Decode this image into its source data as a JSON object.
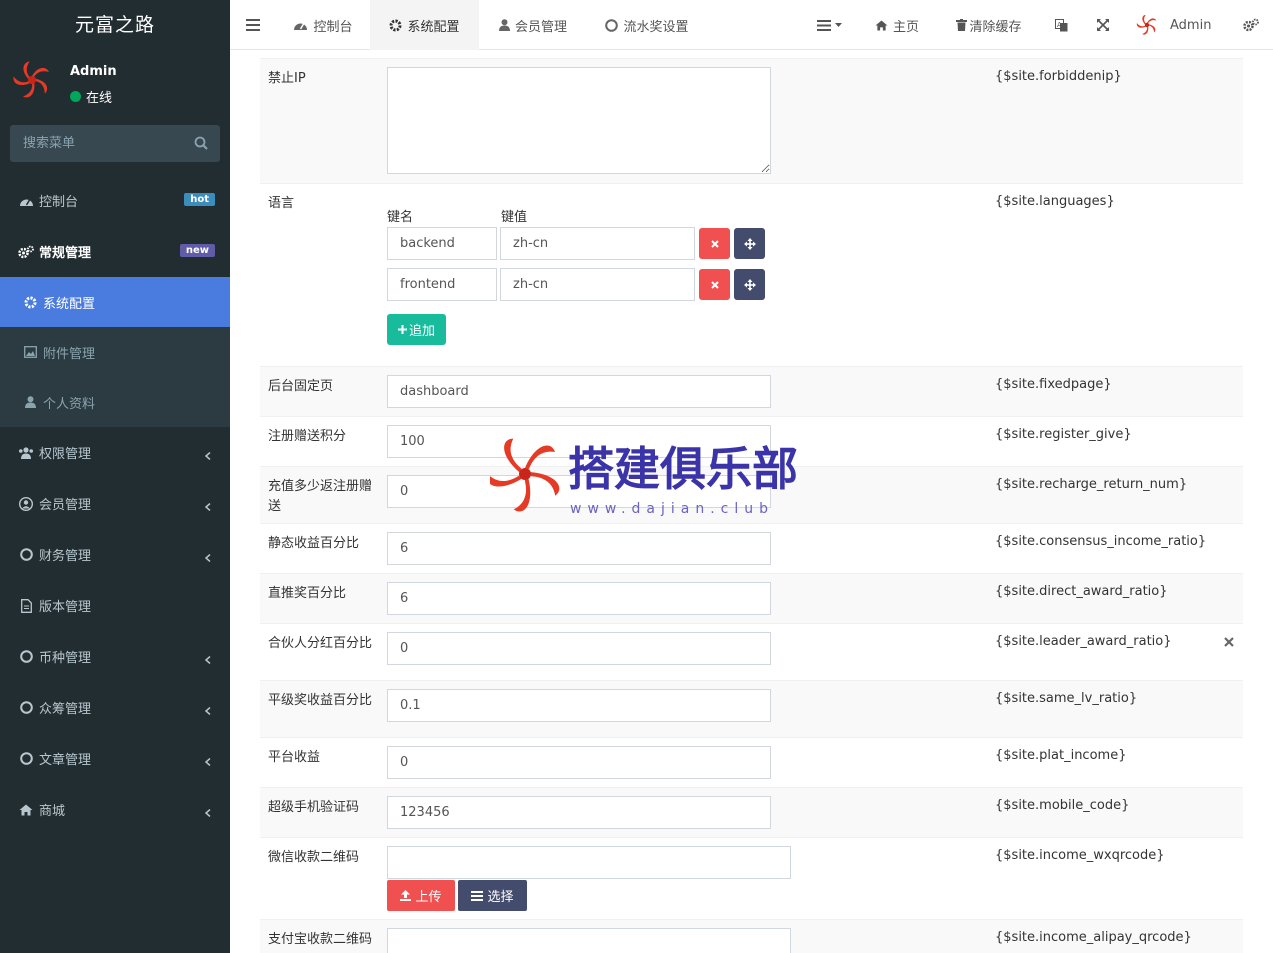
{
  "brand": "元富之路",
  "user": {
    "name": "Admin",
    "status": "在线"
  },
  "search": {
    "placeholder": "搜索菜单"
  },
  "menu": [
    {
      "label": "控制台",
      "icon": "dashboard-icon",
      "badge": "hot",
      "badge_color": "#3c8dbc"
    },
    {
      "label": "常规管理",
      "icon": "cogs-icon",
      "badge": "new",
      "badge_color": "#605ca8"
    }
  ],
  "submenu": [
    {
      "label": "系统配置",
      "icon": "gear-icon",
      "active": true
    },
    {
      "label": "附件管理",
      "icon": "image-icon"
    },
    {
      "label": "个人资料",
      "icon": "user-icon"
    }
  ],
  "menu2": [
    {
      "label": "权限管理",
      "icon": "group-icon"
    },
    {
      "label": "会员管理",
      "icon": "user-circle-icon"
    },
    {
      "label": "财务管理",
      "icon": "circle-icon"
    },
    {
      "label": "版本管理",
      "icon": "file-icon"
    },
    {
      "label": "币种管理",
      "icon": "circle-icon"
    },
    {
      "label": "众筹管理",
      "icon": "circle-icon"
    },
    {
      "label": "文章管理",
      "icon": "circle-icon"
    },
    {
      "label": "商城",
      "icon": "home-icon"
    }
  ],
  "tabs": [
    {
      "label": "控制台",
      "icon": "dashboard-icon"
    },
    {
      "label": "系统配置",
      "icon": "gear-icon",
      "active": true
    },
    {
      "label": "会员管理",
      "icon": "user-icon"
    },
    {
      "label": "流水奖设置",
      "icon": "circle-icon"
    }
  ],
  "navbar_right": {
    "home": "主页",
    "clear_cache": "清除缓存",
    "admin": "Admin"
  },
  "config": {
    "forbiddenip": {
      "label": "禁止IP",
      "var": "{$site.forbiddenip}",
      "value": ""
    },
    "languages": {
      "label": "语言",
      "var": "{$site.languages}",
      "key_header": "键名",
      "value_header": "键值",
      "rows": [
        {
          "key": "backend",
          "value": "zh-cn"
        },
        {
          "key": "frontend",
          "value": "zh-cn"
        }
      ],
      "add_label": "追加"
    },
    "fixedpage": {
      "label": "后台固定页",
      "var": "{$site.fixedpage}",
      "value": "dashboard"
    },
    "register_give": {
      "label": "注册赠送积分",
      "var": "{$site.register_give}",
      "value": "100"
    },
    "recharge_return_num": {
      "label": "充值多少返注册赠送",
      "var": "{$site.recharge_return_num}",
      "value": "0"
    },
    "consensus_income_ratio": {
      "label": "静态收益百分比",
      "var": "{$site.consensus_income_ratio}",
      "value": "6"
    },
    "direct_award_ratio": {
      "label": "直推奖百分比",
      "var": "{$site.direct_award_ratio}",
      "value": "6"
    },
    "leader_award_ratio": {
      "label": "合伙人分红百分比",
      "var": "{$site.leader_award_ratio}",
      "value": "0"
    },
    "same_lv_ratio": {
      "label": "平级奖收益百分比",
      "var": "{$site.same_lv_ratio}",
      "value": "0.1"
    },
    "plat_income": {
      "label": "平台收益",
      "var": "{$site.plat_income}",
      "value": "0"
    },
    "mobile_code": {
      "label": "超级手机验证码",
      "var": "{$site.mobile_code}",
      "value": "123456"
    },
    "income_wxqrcode": {
      "label": "微信收款二维码",
      "var": "{$site.income_wxqrcode}",
      "value": "",
      "upload": "上传",
      "choose": "选择"
    },
    "income_alipay_qrcode": {
      "label": "支付宝收款二维码",
      "var": "{$site.income_alipay_qrcode}",
      "value": ""
    }
  },
  "watermark": {
    "title": "搭建俱乐部",
    "url": "www.dajian.club"
  },
  "colors": {
    "sidebar": "#222d32",
    "active": "#4a7ce0",
    "danger": "#f05050",
    "success": "#18bc9c",
    "dark_btn": "#444c6e"
  }
}
